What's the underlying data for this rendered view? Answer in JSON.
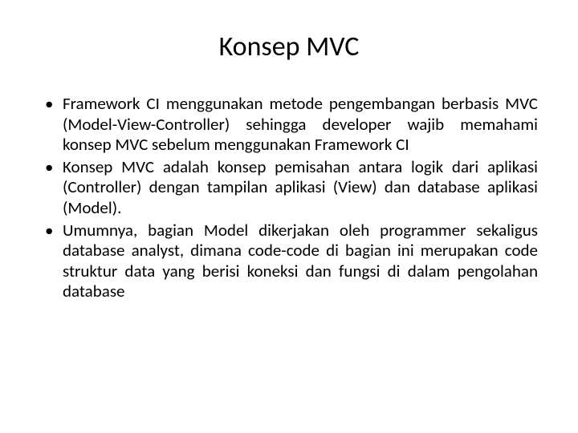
{
  "title": "Konsep MVC",
  "bullets": [
    "Framework CI menggunakan metode pengembangan berbasis MVC (Model-View-Controller) sehingga developer wajib memahami konsep MVC sebelum menggunakan Framework CI",
    "Konsep MVC adalah konsep pemisahan antara logik dari aplikasi (Controller) dengan tampilan aplikasi (View) dan database aplikasi (Model).",
    "Umumnya, bagian Model dikerjakan oleh programmer sekaligus database analyst, dimana code-code di bagian ini merupakan code struktur data yang berisi koneksi dan fungsi di dalam pengolahan database"
  ]
}
